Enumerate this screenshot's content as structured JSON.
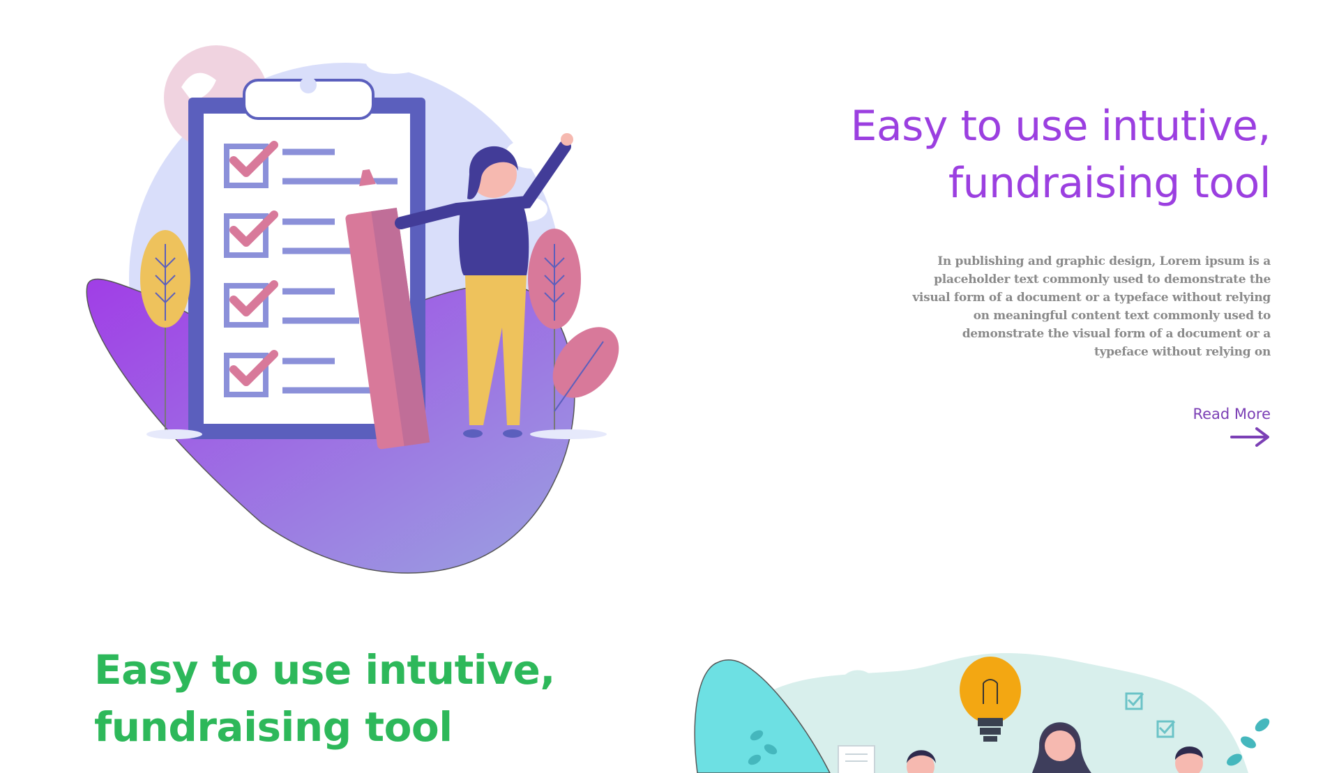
{
  "section1": {
    "heading_line1": "Easy to use intutive,",
    "heading_line2": "fundraising tool",
    "paragraph": "In publishing and graphic design, Lorem ipsum is a placeholder text commonly used to demonstrate the visual form of a document or a typeface without relying on meaningful content  text commonly used to demonstrate the visual form of a document or a typeface without relying on",
    "read_more_label": "Read More",
    "illustration_icon": "checklist-illustration",
    "arrow_icon": "arrow-right-icon"
  },
  "section2": {
    "heading_line1": "Easy to use intutive,",
    "heading_line2": "fundraising tool",
    "illustration_icon": "team-idea-illustration"
  },
  "colors": {
    "heading_purple": "#9b3fe0",
    "heading_green": "#2db85a",
    "body_gray": "#8a8a8a",
    "link_purple": "#7b3fb5"
  }
}
